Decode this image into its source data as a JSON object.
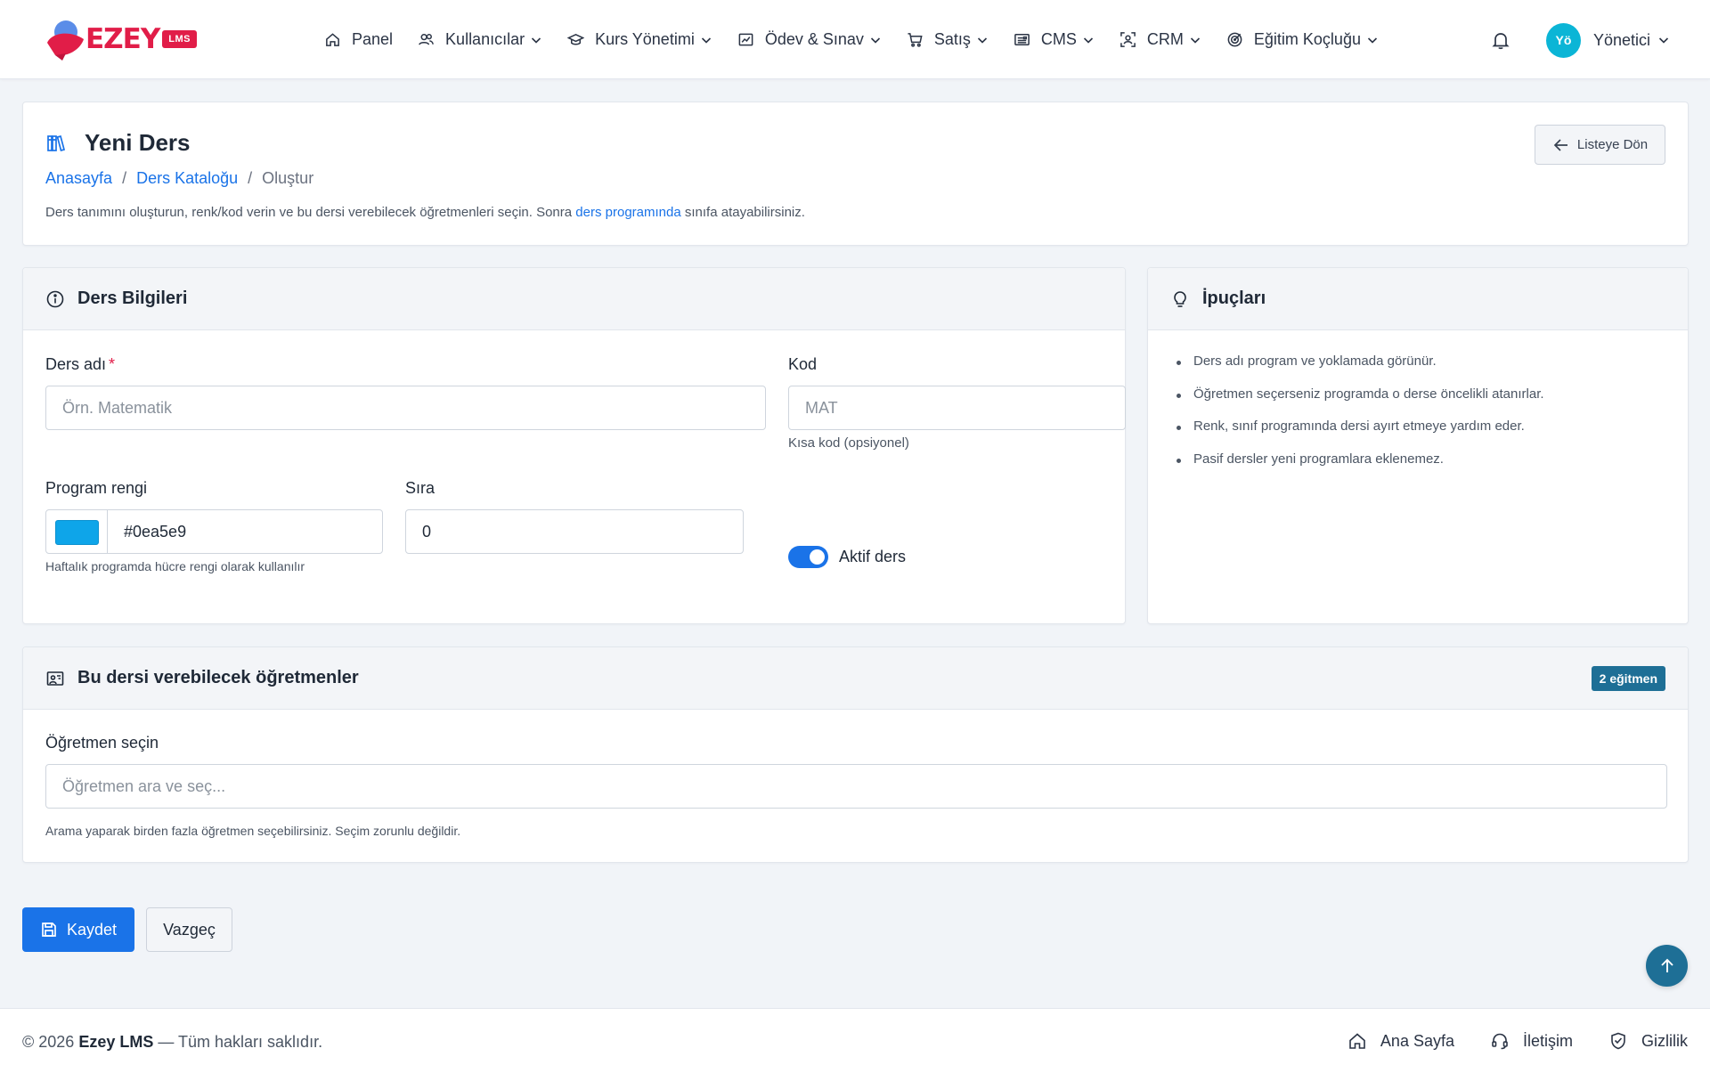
{
  "brand": {
    "name": "EZEY",
    "badge": "LMS"
  },
  "nav": {
    "items": [
      {
        "label": "Panel",
        "icon": "home-icon",
        "dropdown": false
      },
      {
        "label": "Kullanıcılar",
        "icon": "users-icon",
        "dropdown": true
      },
      {
        "label": "Kurs Yönetimi",
        "icon": "graduation-cap-icon",
        "dropdown": true
      },
      {
        "label": "Ödev & Sınav",
        "icon": "chart-board-icon",
        "dropdown": true
      },
      {
        "label": "Satış",
        "icon": "cart-icon",
        "dropdown": true
      },
      {
        "label": "CMS",
        "icon": "news-icon",
        "dropdown": true
      },
      {
        "label": "CRM",
        "icon": "person-scan-icon",
        "dropdown": true
      },
      {
        "label": "Eğitim Koçluğu",
        "icon": "target-icon",
        "dropdown": true
      }
    ]
  },
  "user": {
    "initials": "Yö",
    "name": "Yönetici"
  },
  "page": {
    "title": "Yeni Ders",
    "breadcrumb": {
      "home": "Anasayfa",
      "catalog": "Ders Kataloğu",
      "current": "Oluştur",
      "separator": "/"
    },
    "description_before": "Ders tanımını oluşturun, renk/kod verin ve bu dersi verebilecek öğretmenleri seçin. Sonra ",
    "description_link": "ders programında",
    "description_after": " sınıfa atayabilirsiniz.",
    "back_button": "Listeye Dön"
  },
  "form": {
    "title": "Ders Bilgileri",
    "name_label": "Ders adı",
    "required_mark": "*",
    "name_placeholder": "Örn. Matematik",
    "code_label": "Kod",
    "code_placeholder": "MAT",
    "code_hint": "Kısa kod (opsiyonel)",
    "color_label": "Program rengi",
    "color_value": "#0ea5e9",
    "color_hint": "Haftalık programda hücre rengi olarak kullanılır",
    "order_label": "Sıra",
    "order_value": "0",
    "active_label": "Aktif ders",
    "active": true
  },
  "tips": {
    "title": "İpuçları",
    "items": [
      "Ders adı program ve yoklamada görünür.",
      "Öğretmen seçerseniz programda o derse öncelikli atanırlar.",
      "Renk, sınıf programında dersi ayırt etmeye yardım eder.",
      "Pasif dersler yeni programlara eklenemez."
    ]
  },
  "teachers": {
    "title": "Bu dersi verebilecek öğretmenler",
    "count_badge": "2 eğitmen",
    "select_label": "Öğretmen seçin",
    "select_placeholder": "Öğretmen ara ve seç...",
    "hint": "Arama yaparak birden fazla öğretmen seçebilirsiniz. Seçim zorunlu değildir."
  },
  "actions": {
    "save": "Kaydet",
    "cancel": "Vazgeç"
  },
  "footer": {
    "copyright_prefix": "© 2026 ",
    "copyright_brand": "Ezey LMS",
    "copyright_suffix": " — Tüm hakları saklıdır.",
    "links": {
      "home": "Ana Sayfa",
      "contact": "İletişim",
      "privacy": "Gizlilik"
    }
  },
  "colors": {
    "accent": "#1a73e8",
    "brand": "#e11d48",
    "badge": "#1e6f96",
    "avatar": "#0bb5d6",
    "swatch": "#0ea5e9"
  }
}
